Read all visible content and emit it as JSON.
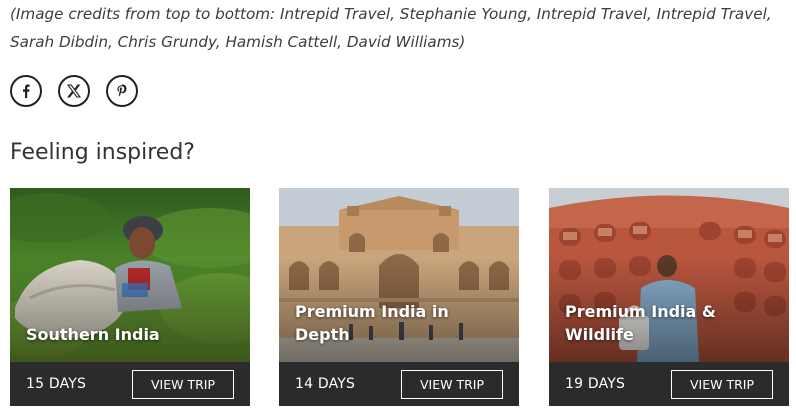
{
  "credits_text": "(Image credits from top to bottom: Intrepid Travel, Stephanie Young, Intrepid Travel, Intrepid Travel, Sarah Dibdin, Chris Grundy, Hamish Cattell, David Williams)",
  "share": {
    "icons": [
      "facebook-icon",
      "x-twitter-icon",
      "pinterest-icon"
    ]
  },
  "section_title": "Feeling inspired?",
  "trips": [
    {
      "title": "Southern India",
      "duration": "15 DAYS",
      "button_label": "VIEW TRIP"
    },
    {
      "title": "Premium India in Depth",
      "duration": "14 DAYS",
      "button_label": "VIEW TRIP"
    },
    {
      "title": "Premium India & Wildlife",
      "duration": "19 DAYS",
      "button_label": "VIEW TRIP"
    }
  ],
  "colors": {
    "footer_bg": "#2b2b2b",
    "text": "#333333"
  }
}
